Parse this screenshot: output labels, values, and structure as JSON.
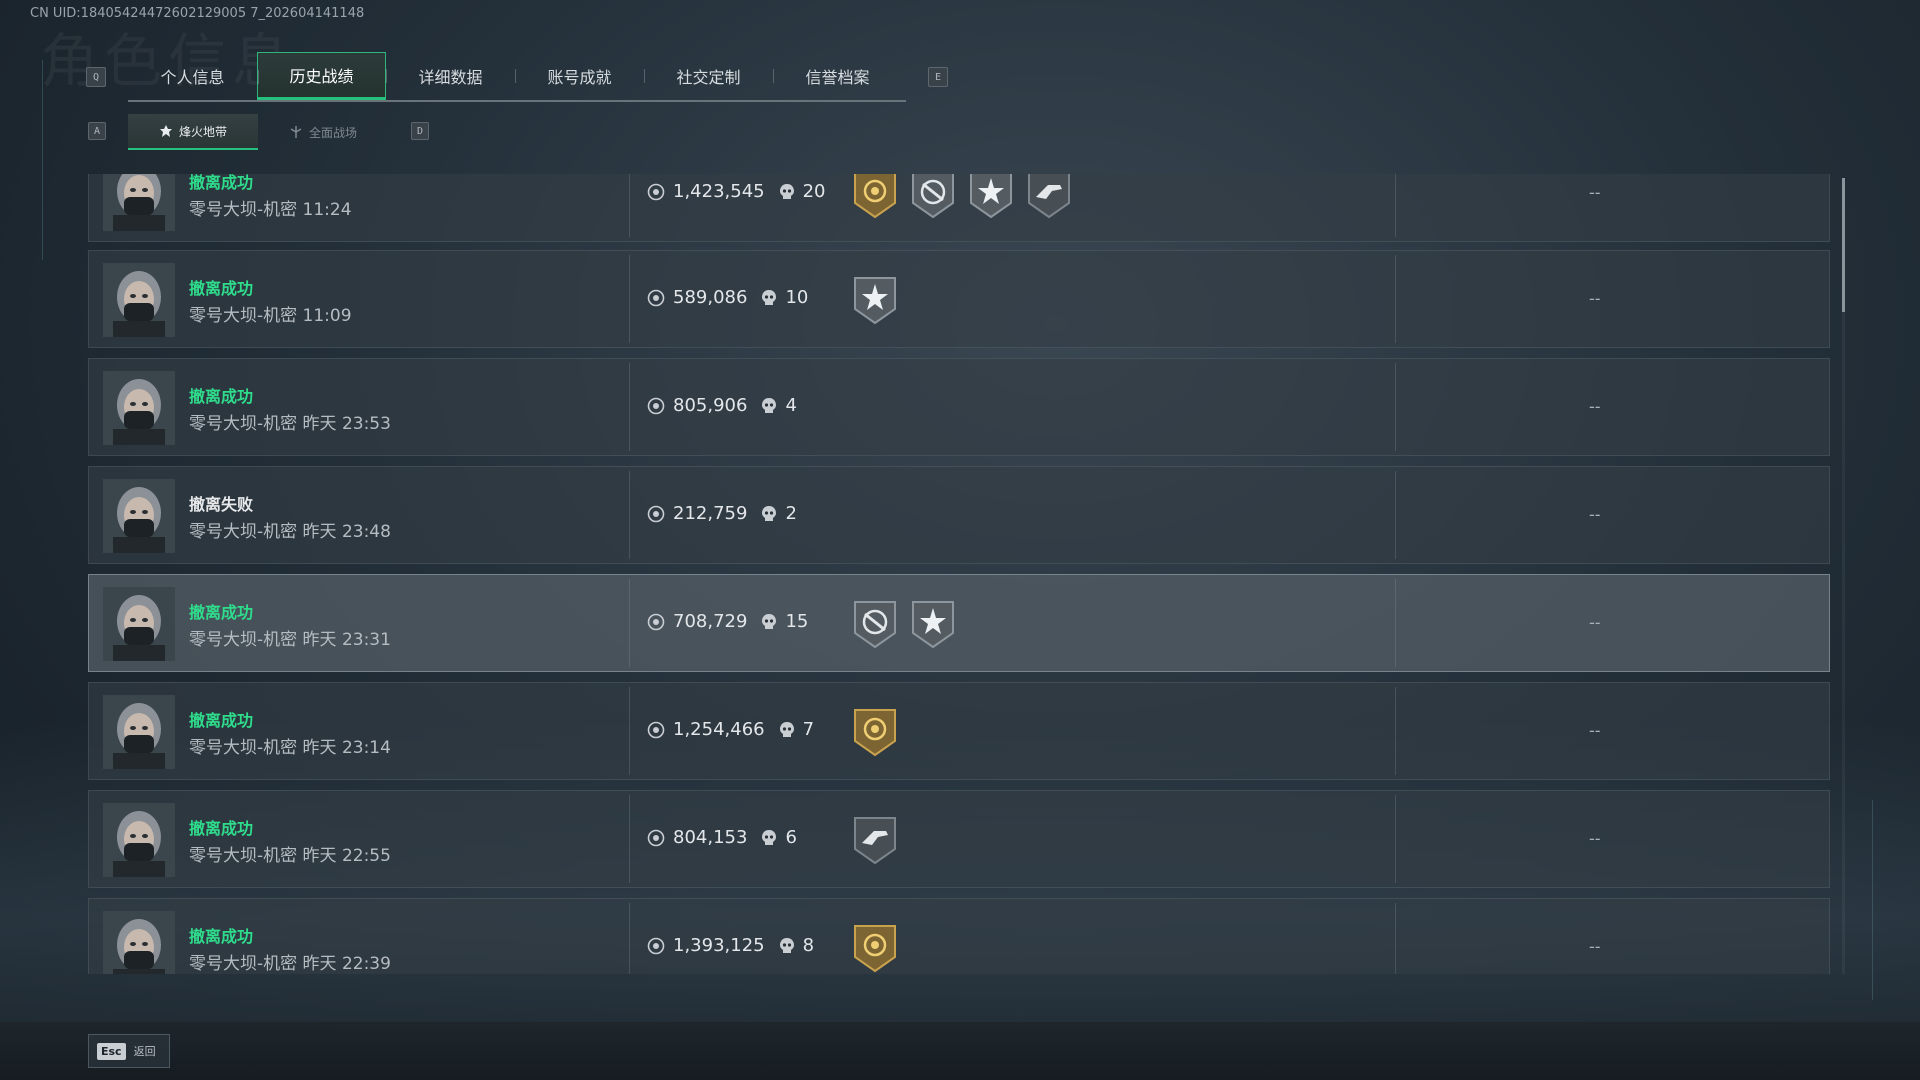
{
  "uid_text": "CN UID:18405424472602129005 7_202604141148",
  "watermark": "角色信息",
  "tabs": {
    "prev_key": "Q",
    "next_key": "E",
    "items": [
      {
        "label": "个人信息",
        "active": false
      },
      {
        "label": "历史战绩",
        "active": true
      },
      {
        "label": "详细数据",
        "active": false
      },
      {
        "label": "账号成就",
        "active": false
      },
      {
        "label": "社交定制",
        "active": false
      },
      {
        "label": "信誉档案",
        "active": false
      }
    ]
  },
  "subtabs": {
    "prev_key": "A",
    "next_key": "D",
    "items": [
      {
        "label": "烽火地带",
        "icon": "hazard-zone-icon",
        "active": true
      },
      {
        "label": "全面战场",
        "icon": "battlefield-icon",
        "active": false
      }
    ]
  },
  "records": [
    {
      "status": "撤离成功",
      "result": "ok",
      "map": "零号大坝-机密 11:24",
      "value": "1,423,545",
      "kills": "20",
      "badges": [
        "gold-coin-badge",
        "crosshair-badge",
        "star-badge",
        "weapon-badge"
      ],
      "extra": "--",
      "highlight": false
    },
    {
      "status": "撤离成功",
      "result": "ok",
      "map": "零号大坝-机密 11:09",
      "value": "589,086",
      "kills": "10",
      "badges": [
        "star-badge"
      ],
      "extra": "--",
      "highlight": false
    },
    {
      "status": "撤离成功",
      "result": "ok",
      "map": "零号大坝-机密 昨天 23:53",
      "value": "805,906",
      "kills": "4",
      "badges": [],
      "extra": "--",
      "highlight": false
    },
    {
      "status": "撤离失败",
      "result": "fail",
      "map": "零号大坝-机密 昨天 23:48",
      "value": "212,759",
      "kills": "2",
      "badges": [],
      "extra": "--",
      "highlight": false
    },
    {
      "status": "撤离成功",
      "result": "ok",
      "map": "零号大坝-机密 昨天 23:31",
      "value": "708,729",
      "kills": "15",
      "badges": [
        "crosshair-badge",
        "star-badge"
      ],
      "extra": "--",
      "highlight": true
    },
    {
      "status": "撤离成功",
      "result": "ok",
      "map": "零号大坝-机密 昨天 23:14",
      "value": "1,254,466",
      "kills": "7",
      "badges": [
        "gold-coin-badge"
      ],
      "extra": "--",
      "highlight": false
    },
    {
      "status": "撤离成功",
      "result": "ok",
      "map": "零号大坝-机密 昨天 22:55",
      "value": "804,153",
      "kills": "6",
      "badges": [
        "weapon-badge"
      ],
      "extra": "--",
      "highlight": false
    },
    {
      "status": "撤离成功",
      "result": "ok",
      "map": "零号大坝-机密 昨天 22:39",
      "value": "1,393,125",
      "kills": "8",
      "badges": [
        "gold-coin-badge"
      ],
      "extra": "--",
      "highlight": false
    }
  ],
  "footer": {
    "key": "Esc",
    "label": "返回"
  },
  "colors": {
    "accent": "#27c17e",
    "success": "#2fdc8c",
    "gold": "#b38a3a"
  }
}
